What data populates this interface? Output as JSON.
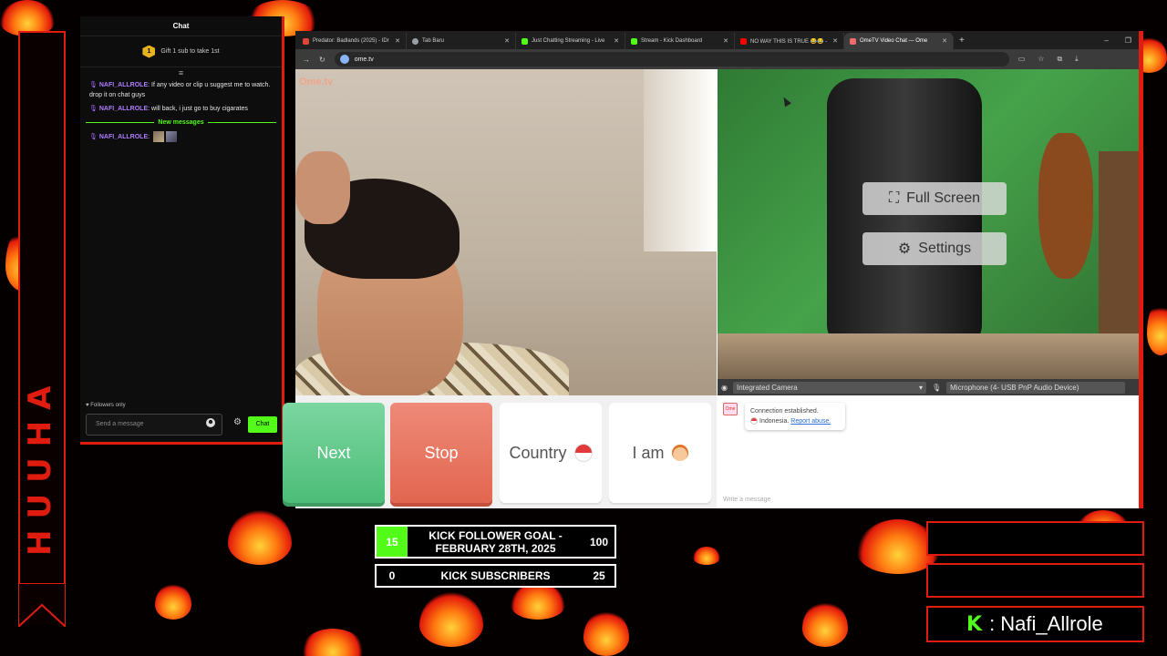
{
  "banner": {
    "text": "HUUHA"
  },
  "chat": {
    "title": "Chat",
    "gift": {
      "badge": "1",
      "text": "Gift 1 sub to take 1st"
    },
    "messages": [
      {
        "user": "NAFI_ALLROLE",
        "text": " If any video or clip u suggest me to watch. drop it on chat guys"
      },
      {
        "user": "NAFI_ALLROLE",
        "text": " will back, i just go to buy cigarates"
      }
    ],
    "new_messages_label": "New messages",
    "emote_message": {
      "user": "NAFI_ALLROLE"
    },
    "followers_only": "♥ Followers only",
    "input_placeholder": "Send a message",
    "send_label": "Chat"
  },
  "browser": {
    "tabs": [
      {
        "title": "Predator: Badlands (2025) - IDr",
        "color": "#e0453a"
      },
      {
        "title": "Tab Baru",
        "color": "#9aa0a6"
      },
      {
        "title": "Just Chatting Streaming - Live",
        "color": "#53fc18"
      },
      {
        "title": "Stream - Kick Dashboard",
        "color": "#53fc18"
      },
      {
        "title": "NO WAY THIS IS TRUE 😂😂 -",
        "color": "#ff0000"
      },
      {
        "title": "OmeTV Video Chat — Ome",
        "color": "#f26b6b",
        "active": true
      }
    ],
    "url": "ome.tv"
  },
  "ometv": {
    "logo": "Ome.tv",
    "overlay": {
      "fullscreen": "Full Screen",
      "settings": "Settings"
    },
    "camera_device": "Integrated Camera",
    "mic_device": "Microphone (4- USB PnP Audio Device)",
    "buttons": {
      "next": "Next",
      "stop": "Stop",
      "country": "Country",
      "iam": "I am"
    },
    "system_message": {
      "line1": "Connection established.",
      "country": "Indonesia.",
      "report": "Report abuse."
    },
    "write_placeholder": "Write a message"
  },
  "goals": {
    "follower": {
      "current": "15",
      "label": "KICK FOLLOWER GOAL - FEBRUARY 28TH, 2025",
      "target": "100"
    },
    "subscribers": {
      "current": "0",
      "label": "KICK SUBSCRIBERS",
      "target": "25"
    }
  },
  "streamer": {
    "name": ": Nafi_Allrole",
    "logo": "K"
  }
}
